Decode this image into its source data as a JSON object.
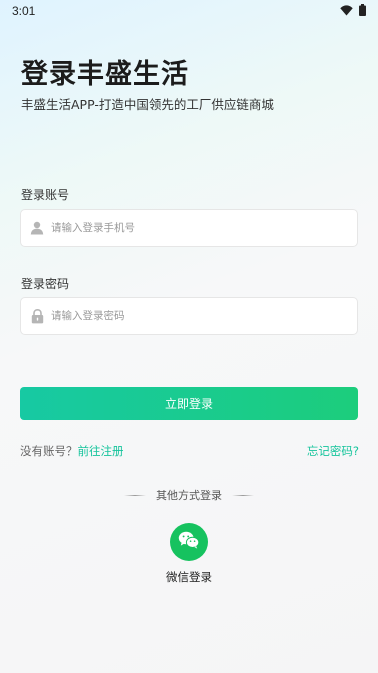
{
  "status_bar": {
    "time": "3:01",
    "icons": [
      "wifi-icon",
      "battery-icon"
    ]
  },
  "header": {
    "title": "登录丰盛生活",
    "subtitle": "丰盛生活APP-打造中国领先的工厂供应链商城"
  },
  "account": {
    "label": "登录账号",
    "placeholder": "请输入登录手机号",
    "value": "",
    "icon": "user-icon"
  },
  "password": {
    "label": "登录密码",
    "placeholder": "请输入登录密码",
    "value": "",
    "icon": "lock-icon"
  },
  "login_button": {
    "label": "立即登录"
  },
  "register": {
    "prompt": "没有账号？",
    "link": "前往注册"
  },
  "forgot": {
    "label": "忘记密码?"
  },
  "other_login": {
    "title": "其他方式登录",
    "wechat_label": "微信登录",
    "wechat_icon": "wechat-icon"
  },
  "colors": {
    "accent": "#15c49c",
    "button_start": "#17c9a3",
    "button_end": "#1ccd7c",
    "wechat_green": "#16c25f"
  }
}
